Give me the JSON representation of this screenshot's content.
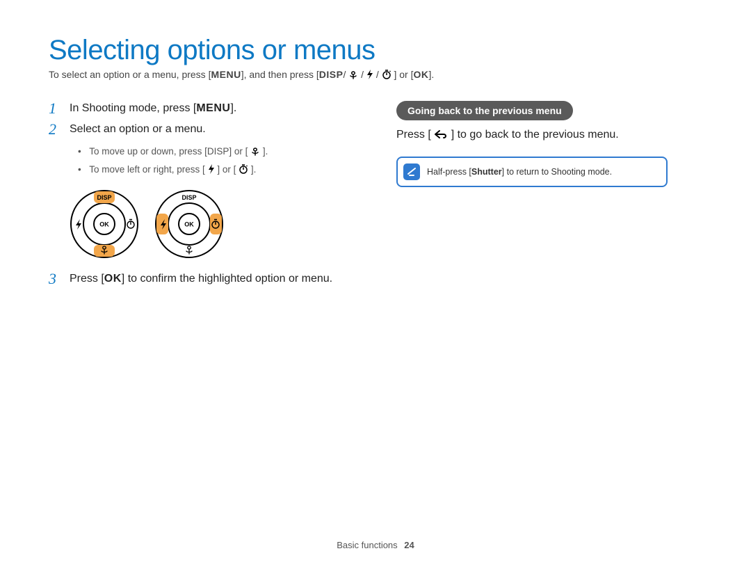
{
  "title": "Selecting options or menus",
  "intro": {
    "pre": "To select an option or a menu, press [",
    "menu": "MENU",
    "mid": "], and then press [",
    "disp": "DISP",
    "or_post": "] or [",
    "ok": "OK",
    "end": "]."
  },
  "steps": [
    {
      "num": "1",
      "text_pre": "In Shooting mode, press [",
      "kw": "MENU",
      "text_post": "]."
    },
    {
      "num": "2",
      "text": "Select an option or a menu.",
      "bullets": [
        {
          "pre": "To move up or down, press [",
          "kw": "DISP",
          "mid": "] or [",
          "post": "]."
        },
        {
          "pre": "To move left or right, press [",
          "mid2": "] or [",
          "post": "]."
        }
      ]
    },
    {
      "num": "3",
      "text_pre": "Press [",
      "kw": "OK",
      "text_post": "] to confirm the highlighted option or menu."
    }
  ],
  "dials": {
    "top": "DISP",
    "ok": "OK"
  },
  "right": {
    "pill": "Going back to the previous menu",
    "line_pre": "Press [",
    "line_post": "] to go back to the previous menu.",
    "note_pre": "Half-press [",
    "note_kw": "Shutter",
    "note_post": "] to return to Shooting mode."
  },
  "footer": {
    "section": "Basic functions",
    "page": "24"
  }
}
